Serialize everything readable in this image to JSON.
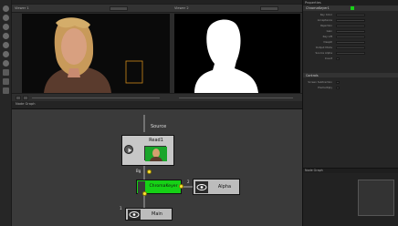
{
  "toolbar": {
    "tools": [
      "select-tool",
      "zoom-tool",
      "pan-tool",
      "paint-tool",
      "roto-tool",
      "transform-tool",
      "color-tool",
      "filter-tool",
      "keyer-tool",
      "time-tool",
      "merge-tool",
      "channel-tool",
      "misc-tool",
      "script-tool"
    ]
  },
  "viewer_a": {
    "title": "Viewer 1",
    "label": "A",
    "buttons": [
      "RGBA",
      "Keyer"
    ]
  },
  "viewer_b": {
    "title": "Viewer 2",
    "label": "B",
    "buttons": [
      "RGBA",
      "Alpha"
    ]
  },
  "nodegraph": {
    "header": "Node Graph",
    "source_label": "Source",
    "nodes": {
      "read": "Read1",
      "keyer": "ChromaKeyer",
      "alpha": "Alpha",
      "main": "Main"
    },
    "port_labels": {
      "bg": "Bg",
      "alpha_in": "2",
      "main_in": "1"
    }
  },
  "properties": {
    "title": "Properties",
    "sections": [
      "ChromaKeyer1",
      "Controls"
    ],
    "rows": [
      "Key Color",
      "Acceptance",
      "Rejection",
      "Gain",
      "Key Lift",
      "Despill",
      "Output Mode",
      "Source Alpha",
      "Invert",
      "Screen Subtraction",
      "Premultiply"
    ]
  },
  "minimap": {
    "title": "Node Graph"
  },
  "colors": {
    "keyer_green": "#16d116",
    "port_yellow": "#ffe23a",
    "node_gray": "#c7c7c7"
  }
}
